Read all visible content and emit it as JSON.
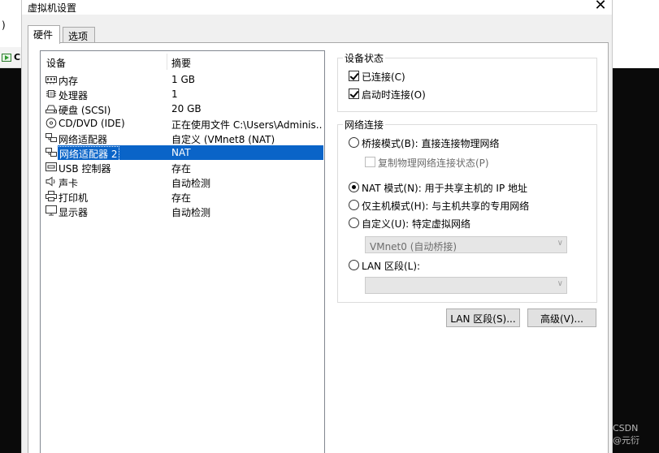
{
  "window": {
    "title": "虚拟机设置",
    "close_glyph": "✕"
  },
  "background": {
    "left_paren": ")",
    "left_toolbar_char": "C",
    "watermark": "CSDN @元衍"
  },
  "tabs": [
    {
      "label": "硬件",
      "active": true
    },
    {
      "label": "选项",
      "active": false
    }
  ],
  "devices": {
    "col_device": "设备",
    "col_summary": "摘要",
    "rows": [
      {
        "name": "内存",
        "summary": "1 GB",
        "icon": "memory-icon"
      },
      {
        "name": "处理器",
        "summary": "1",
        "icon": "processor-icon"
      },
      {
        "name": "硬盘 (SCSI)",
        "summary": "20 GB",
        "icon": "harddisk-icon"
      },
      {
        "name": "CD/DVD (IDE)",
        "summary": "正在使用文件 C:\\Users\\Adminis...",
        "icon": "cd-dvd-icon"
      },
      {
        "name": "网络适配器",
        "summary": "自定义 (VMnet8 (NAT)",
        "icon": "network-adapter-icon"
      },
      {
        "name": "网络适配器 2",
        "summary": "NAT",
        "icon": "network-adapter-icon",
        "selected": true
      },
      {
        "name": "USB 控制器",
        "summary": "存在",
        "icon": "usb-icon"
      },
      {
        "name": "声卡",
        "summary": "自动检测",
        "icon": "sound-card-icon"
      },
      {
        "name": "打印机",
        "summary": "存在",
        "icon": "printer-icon"
      },
      {
        "name": "显示器",
        "summary": "自动检测",
        "icon": "display-icon"
      }
    ]
  },
  "device_status": {
    "legend": "设备状态",
    "connected": {
      "label": "已连接(C)",
      "checked": true
    },
    "connect_at_power_on": {
      "label": "启动时连接(O)",
      "checked": true
    }
  },
  "network": {
    "legend": "网络连接",
    "bridged": {
      "label": "桥接模式(B): 直接连接物理网络",
      "selected": false
    },
    "replicate": {
      "label": "复制物理网络连接状态(P)",
      "checked": false,
      "disabled": true
    },
    "nat": {
      "label": "NAT 模式(N): 用于共享主机的 IP 地址",
      "selected": true
    },
    "hostonly": {
      "label": "仅主机模式(H): 与主机共享的专用网络",
      "selected": false
    },
    "custom": {
      "label": "自定义(U): 特定虚拟网络",
      "selected": false
    },
    "custom_select": "VMnet0 (自动桥接)",
    "lan": {
      "label": "LAN 区段(L):",
      "selected": false
    },
    "lan_select": ""
  },
  "buttons": {
    "lan_segments": "LAN 区段(S)...",
    "advanced": "高级(V)..."
  }
}
